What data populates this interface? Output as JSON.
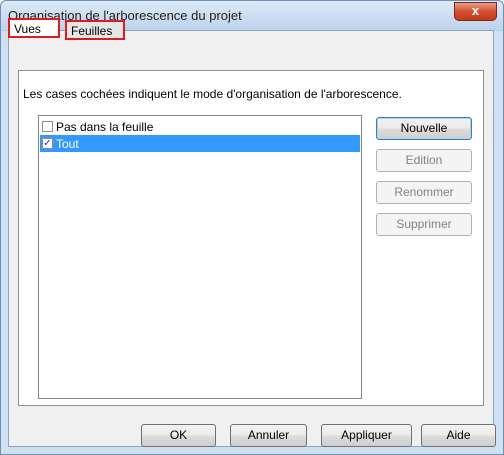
{
  "window": {
    "title": "Organisation de l'arborescence du projet",
    "close_glyph": "x"
  },
  "tabs": [
    {
      "label": "Vues",
      "active": true
    },
    {
      "label": "Feuilles",
      "active": false
    }
  ],
  "panel": {
    "description": "Les cases cochées indiquent le mode d'organisation de l'arborescence.",
    "list": [
      {
        "label": "Pas dans la feuille",
        "checked": false,
        "selected": false
      },
      {
        "label": "Tout",
        "checked": true,
        "selected": true
      }
    ]
  },
  "side_buttons": {
    "new": "Nouvelle",
    "edit": "Edition",
    "rename": "Renommer",
    "delete": "Supprimer"
  },
  "footer_buttons": {
    "ok": "OK",
    "cancel": "Annuler",
    "apply": "Appliquer",
    "help": "Aide"
  },
  "colors": {
    "selection": "#3399ff",
    "tab_highlight": "#e01b1b"
  }
}
